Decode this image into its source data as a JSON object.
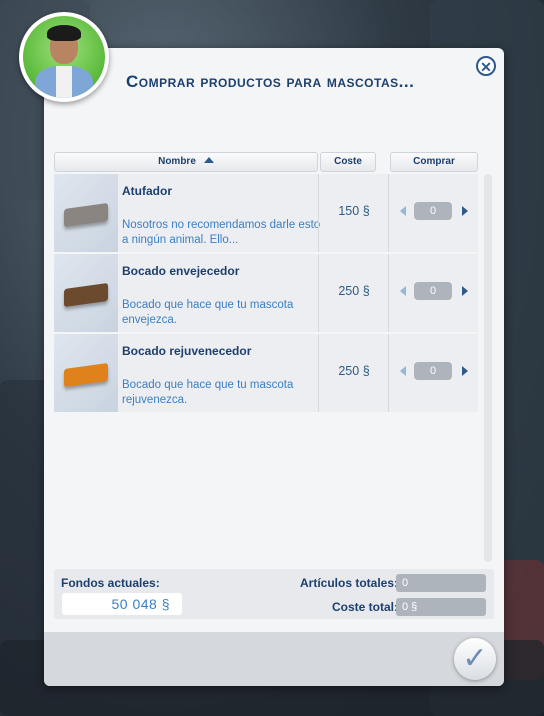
{
  "dialog": {
    "title": "Comprar productos para mascotas...",
    "close_icon": "close-icon",
    "confirm_icon": "checkmark-icon"
  },
  "columns": {
    "name": "Nombre",
    "cost": "Coste",
    "buy": "Comprar"
  },
  "items": [
    {
      "name": "Atufador",
      "description": "Nosotros no recomendamos darle esto a ningún animal. Ello...",
      "cost": "150 §",
      "quantity": "0",
      "color": "#8a8580"
    },
    {
      "name": "Bocado envejecedor",
      "description": "Bocado que hace que tu mascota envejezca.",
      "cost": "250 §",
      "quantity": "0",
      "color": "#6b4a2e"
    },
    {
      "name": "Bocado rejuvenecedor",
      "description": "Bocado que hace que tu mascota rejuvenezca.",
      "cost": "250 §",
      "quantity": "0",
      "color": "#e0821c"
    }
  ],
  "footer": {
    "funds_label": "Fondos actuales:",
    "funds_value": "50 048 §",
    "total_items_label": "Artículos totales:",
    "total_items_value": "0",
    "total_cost_label": "Coste total:",
    "total_cost_value": "0 §"
  }
}
